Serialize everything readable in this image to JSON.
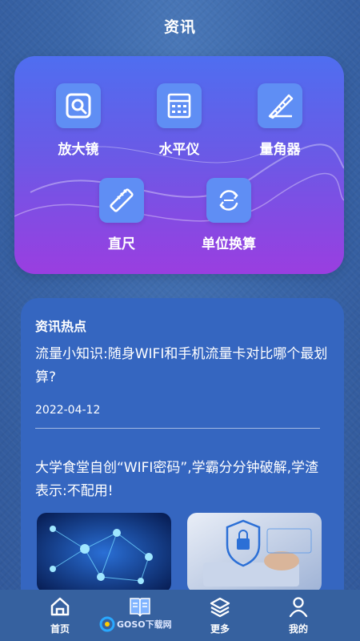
{
  "header": {
    "title": "资讯"
  },
  "tools": [
    {
      "label": "放大镜",
      "icon": "magnifier-icon"
    },
    {
      "label": "水平仪",
      "icon": "level-icon"
    },
    {
      "label": "量角器",
      "icon": "protractor-icon"
    },
    {
      "label": "直尺",
      "icon": "ruler-icon"
    },
    {
      "label": "单位换算",
      "icon": "unit-convert-icon"
    }
  ],
  "news": {
    "section_title": "资讯热点",
    "items": [
      {
        "title": "流量小知识:随身WIFI和手机流量卡对比哪个最划算?",
        "date": "2022-04-12"
      },
      {
        "title": "大学食堂自创“WIFI密码”,学霸分分钟破解,学渣表示:不配用!"
      }
    ]
  },
  "nav": [
    {
      "label": "首页",
      "icon": "home-icon"
    },
    {
      "label": "",
      "icon": "book-icon"
    },
    {
      "label": "更多",
      "icon": "layers-icon"
    },
    {
      "label": "我的",
      "icon": "user-icon"
    }
  ],
  "watermark": {
    "text": "GOSO下载网"
  },
  "colors": {
    "accent": "#5f8ef4",
    "card_top": "#4f6ef0",
    "card_bottom": "#9a3ee0",
    "news_bg": "#3566c0"
  }
}
